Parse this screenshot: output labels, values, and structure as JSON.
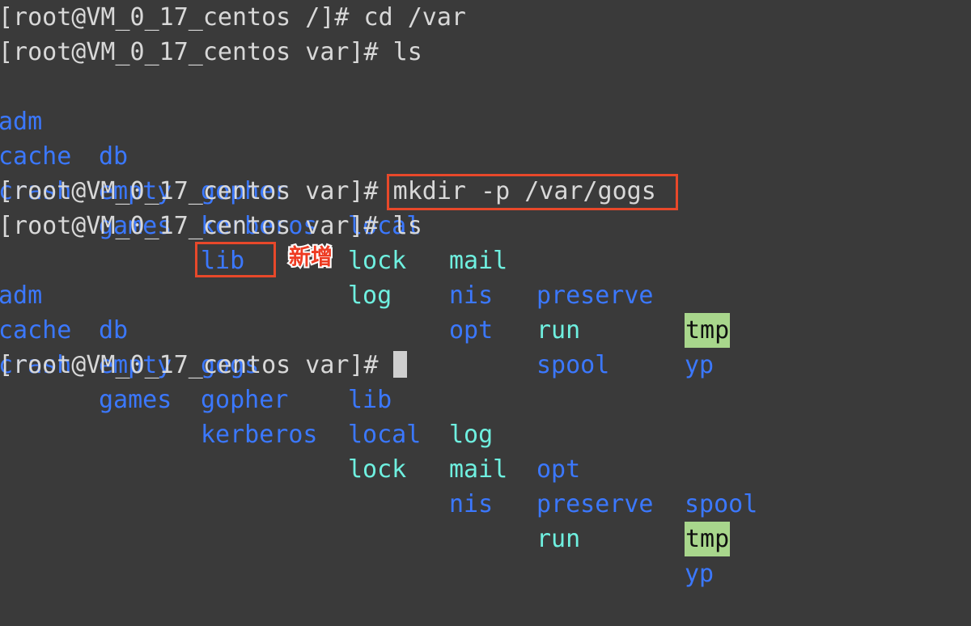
{
  "terminal": {
    "background_color": "#3a3a3a",
    "foreground_color": "#d8d8d8",
    "dir_color": "#3b78ff",
    "link_color": "#6ff0e0",
    "sticky_bg_color": "#a8d68c",
    "sticky_fg_color": "#101010",
    "annotation_color": "#ee3b22",
    "highlight_box_color": "#e8482a",
    "cursor_color": "#cfcfcf"
  },
  "lines": {
    "l1_prompt": "[root@VM_0_17_centos /]# ",
    "l1_command": "cd /var",
    "l2_prompt": "[root@VM_0_17_centos var]# ",
    "l2_command": "ls",
    "l6_prompt": "[root@VM_0_17_centos var]# ",
    "l6_command": "mkdir -p /var/gogs",
    "l7_prompt": "[root@VM_0_17_centos var]# ",
    "l7_command": "ls",
    "l12_prompt": "[root@VM_0_17_centos var]# ",
    "l12_command": ""
  },
  "ls_first": {
    "rows": [
      [
        {
          "name": "adm",
          "kind": "dir"
        },
        {
          "name": "db",
          "kind": "dir"
        },
        {
          "name": "gopher",
          "kind": "dir"
        },
        {
          "name": "local",
          "kind": "dir"
        },
        {
          "name": "mail",
          "kind": "link"
        },
        {
          "name": "preserve",
          "kind": "dir"
        },
        {
          "name": "tmp",
          "kind": "sticky"
        }
      ],
      [
        {
          "name": "cache",
          "kind": "dir"
        },
        {
          "name": "empty",
          "kind": "dir"
        },
        {
          "name": "kerberos",
          "kind": "dir"
        },
        {
          "name": "lock",
          "kind": "link"
        },
        {
          "name": "nis",
          "kind": "dir"
        },
        {
          "name": "run",
          "kind": "link"
        },
        {
          "name": "yp",
          "kind": "dir"
        }
      ],
      [
        {
          "name": "crash",
          "kind": "dir"
        },
        {
          "name": "games",
          "kind": "dir"
        },
        {
          "name": "lib",
          "kind": "dir"
        },
        {
          "name": "log",
          "kind": "link"
        },
        {
          "name": "opt",
          "kind": "dir"
        },
        {
          "name": "spool",
          "kind": "dir"
        },
        {
          "name": "",
          "kind": "dir"
        }
      ]
    ]
  },
  "ls_second": {
    "rows": [
      [
        {
          "name": "adm",
          "kind": "dir"
        },
        {
          "name": "db",
          "kind": "dir"
        },
        {
          "name": "gogs",
          "kind": "dir"
        },
        {
          "name": "lib",
          "kind": "dir"
        },
        {
          "name": "log",
          "kind": "link"
        },
        {
          "name": "opt",
          "kind": "dir"
        },
        {
          "name": "spool",
          "kind": "dir"
        }
      ],
      [
        {
          "name": "cache",
          "kind": "dir"
        },
        {
          "name": "empty",
          "kind": "dir"
        },
        {
          "name": "gopher",
          "kind": "dir"
        },
        {
          "name": "local",
          "kind": "dir"
        },
        {
          "name": "mail",
          "kind": "link"
        },
        {
          "name": "preserve",
          "kind": "dir"
        },
        {
          "name": "tmp",
          "kind": "sticky"
        }
      ],
      [
        {
          "name": "crash",
          "kind": "dir"
        },
        {
          "name": "games",
          "kind": "dir"
        },
        {
          "name": "kerberos",
          "kind": "dir"
        },
        {
          "name": "lock",
          "kind": "link"
        },
        {
          "name": "nis",
          "kind": "dir"
        },
        {
          "name": "run",
          "kind": "link"
        },
        {
          "name": "yp",
          "kind": "dir"
        }
      ]
    ]
  },
  "annotations": {
    "new_label": "新增"
  }
}
